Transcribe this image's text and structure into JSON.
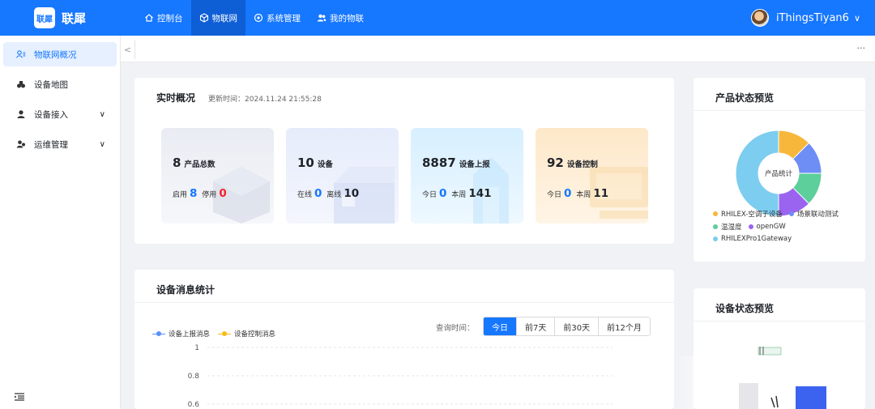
{
  "app": {
    "logo_mark": "联犀",
    "name": "联犀"
  },
  "topnav": [
    {
      "label": "控制台",
      "icon": "home-icon"
    },
    {
      "label": "物联网",
      "icon": "cube-icon",
      "active": true
    },
    {
      "label": "系统管理",
      "icon": "settings-icon"
    },
    {
      "label": "我的物联",
      "icon": "users-icon"
    }
  ],
  "user": {
    "name": "iThingsTiyan6",
    "chevron": "∨"
  },
  "sidebar": {
    "items": [
      {
        "label": "物联网概况",
        "icon": "overview-icon",
        "active": true
      },
      {
        "label": "设备地图",
        "icon": "map-icon"
      },
      {
        "label": "设备接入",
        "icon": "user-icon",
        "expandable": true
      },
      {
        "label": "运维管理",
        "icon": "ops-icon",
        "expandable": true
      }
    ],
    "collapse_icon": "menu-fold-icon"
  },
  "tabbar": {
    "left": "<",
    "more": "···"
  },
  "realtime": {
    "title": "实时概况",
    "updated_label": "更新时间：2024.11.24 21:55:28",
    "cards": [
      {
        "value": "8",
        "label": "产品总数",
        "a_label": "启用",
        "a_value": "8",
        "b_label": "停用",
        "b_value": "0"
      },
      {
        "value": "10",
        "label": "设备",
        "a_label": "在线",
        "a_value": "0",
        "b_label": "离线",
        "b_value": "10"
      },
      {
        "value": "8887",
        "label": "设备上报",
        "a_label": "今日",
        "a_value": "0",
        "b_label": "本周",
        "b_value": "141"
      },
      {
        "value": "92",
        "label": "设备控制",
        "a_label": "今日",
        "a_value": "0",
        "b_label": "本周",
        "b_value": "11"
      }
    ]
  },
  "messages": {
    "title": "设备消息统计",
    "legend": [
      {
        "name": "设备上报消息",
        "color": "#5b8ff9"
      },
      {
        "name": "设备控制消息",
        "color": "#f6bd16"
      }
    ],
    "query_label": "查询时间：",
    "ranges": [
      "今日",
      "前7天",
      "前30天",
      "前12个月"
    ],
    "selected_range": "今日",
    "chart_data": {
      "type": "line",
      "y_ticks": [
        "1",
        "0.8",
        "0.6"
      ],
      "series": [
        {
          "name": "设备上报消息",
          "values": []
        },
        {
          "name": "设备控制消息",
          "values": []
        }
      ]
    }
  },
  "product_status": {
    "title": "产品状态预览",
    "center_label": "产品统计",
    "chart_data": {
      "type": "pie",
      "slices": [
        {
          "name": "RHILEX-空调子设备",
          "value": 1,
          "color": "#f7b73b"
        },
        {
          "name": "场景联动测试",
          "value": 1,
          "color": "#6e8ef5"
        },
        {
          "name": "温湿度",
          "value": 1,
          "color": "#5ccf9a"
        },
        {
          "name": "openGW",
          "value": 1,
          "color": "#9a64f0"
        },
        {
          "name": "RHILEXPro1Gateway",
          "value": 4,
          "color": "#7ccdef"
        }
      ]
    }
  },
  "device_status": {
    "title": "设备状态预览"
  }
}
